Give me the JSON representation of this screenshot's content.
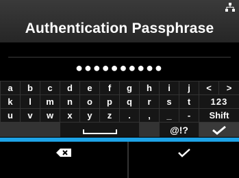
{
  "header": {
    "title": "Authentication Passphrase",
    "status_icon": "network-icon"
  },
  "field": {
    "value": "●●●●●●●●●●"
  },
  "keyboard": {
    "rows": [
      [
        "a",
        "b",
        "c",
        "d",
        "e",
        "f",
        "g",
        "h",
        "i",
        "j",
        "<",
        ">"
      ],
      [
        "k",
        "l",
        "m",
        "n",
        "o",
        "p",
        "q",
        "r",
        "s",
        "t",
        "123"
      ],
      [
        "u",
        "v",
        "w",
        "x",
        "y",
        "z",
        ".",
        ",",
        "_",
        "-",
        "Shift"
      ]
    ],
    "bottom_row": {
      "space_icon": "space-bar-icon",
      "symbols_label": "@!?",
      "confirm_icon": "checkmark-icon"
    }
  },
  "softkeys": {
    "left_icon": "backspace-icon",
    "right_icon": "checkmark-icon"
  },
  "colors": {
    "accent": "#1ea3e6",
    "key_background": "#161616",
    "keyboard_background": "#333333",
    "title_background": "#2d2d2d"
  }
}
